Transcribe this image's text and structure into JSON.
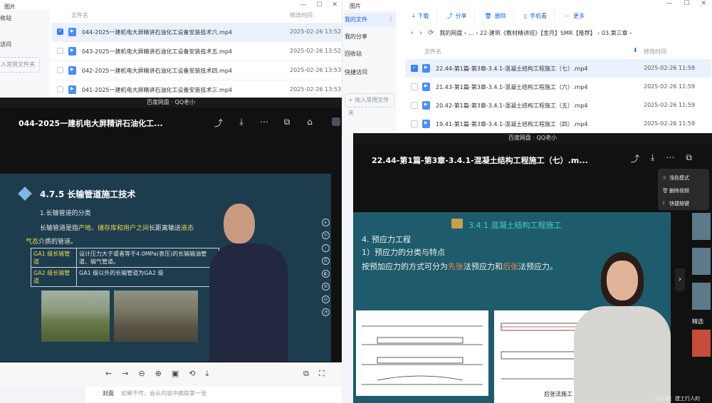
{
  "left_window": {
    "title": "图片",
    "controls": [
      "—",
      "☐",
      "✕"
    ],
    "sidebar": {
      "item1": "收站",
      "item2": "访问",
      "add_btn": "入常用文件夹"
    },
    "header": {
      "name": "文件名",
      "date": "修改时间"
    },
    "rows": [
      {
        "name": "044-2025一建机电大屏精讲石油化工设备安装技术六.mp4",
        "date": "2025-02-26 13:52",
        "selected": true
      },
      {
        "name": "043-2025一建机电大屏精讲石油化工设备安装技术五.mp4",
        "date": "2025-02-26 13:52",
        "selected": false
      },
      {
        "name": "042-2025一建机电大屏精讲石油化工设备安装技术四.mp4",
        "date": "2025-02-26 13:53",
        "selected": false
      },
      {
        "name": "041-2025一建机电大屏精讲石油化工设备安装技术三.mp4",
        "date": "2025-02-26 13:53",
        "selected": false
      }
    ]
  },
  "right_window": {
    "title": "图片",
    "controls": [
      "—",
      "☐",
      "✕"
    ],
    "sidebar": {
      "recent": "我的文件",
      "more": "⋮",
      "share": "我的分享",
      "recycle": "回收站",
      "quick": "快捷访问",
      "add_btn": "+ 拖入常用文件夹"
    },
    "toolbar": {
      "download": "下载",
      "share": "分享",
      "delete": "删除",
      "phone": "手机看",
      "more": "更多"
    },
    "breadcrumb": {
      "back": "‹",
      "forward": "›",
      "refresh": "⟳",
      "path": "我的网盘 › … › 22-建筑《教材精讲班》【金月】SMR【推荐】 › 03.第三章 ›"
    },
    "header": {
      "name": "文件名",
      "sort": "⬇",
      "date": "修改时间"
    },
    "rows": [
      {
        "name": "22.44-第1篇-第3章-3.4.1-混凝土结构工程施工（七）.mp4",
        "date": "2025-02-26 11:59",
        "selected": true
      },
      {
        "name": "21.43-第1篇-第3章-3.4.1-混凝土结构工程施工（六）.mp4",
        "date": "2025-02-26 11:59",
        "selected": false
      },
      {
        "name": "20.42-第1篇-第3章-3.4.1-混凝土结构工程施工（五）.mp4",
        "date": "2025-02-26 11:59",
        "selected": false
      },
      {
        "name": "19.41-第1篇-第3章-3.4.1-混凝土结构工程施工（四）.mp4",
        "date": "2025-02-26 11:59",
        "selected": false
      }
    ]
  },
  "left_player": {
    "app_bar": "百度网盘 · QQ老小",
    "title": "044-2025一建机电大屏精讲石油化工...",
    "actions": {
      "share": "⤴",
      "download": "⤓",
      "more": "⋯",
      "pip": "⧉",
      "pin": "⌂"
    },
    "slide": {
      "heading": "4.7.5  长输管道施工技术",
      "line1": "1.长输管道的分类",
      "line2_a": "长输管道是指",
      "line2_b": "产地、储存库和用户之间",
      "line2_c": "长距离输送",
      "line2_d": "液态",
      "line3_a": "气态",
      "line3_b": "介质的管道。",
      "table": [
        {
          "k": "GA1 级长输管道",
          "v": "设计压力大于或者等于4.0MPa(表压)的长输输油管道、输气管道。"
        },
        {
          "k": "GA2 级长输管道",
          "v": "GA1 级以外的长输管道为GA2 级"
        }
      ]
    },
    "side_ctrls": [
      "▸",
      "↻",
      "›",
      "☰",
      "◐",
      "⚙",
      "⊖",
      "◔"
    ],
    "bottom_ctrls": [
      "←",
      "→",
      "⊖",
      "⊕",
      "▣",
      "⟲",
      "⤓"
    ],
    "bottom_right": [
      "⧉",
      "⛶"
    ],
    "cover_label": "封面",
    "cover_hint": "如果不传，会从内容中摘取第一张"
  },
  "right_player": {
    "app_bar": "百度网盘 · QQ老小",
    "title": "22.44-第1篇-第3章-3.4.1-混凝土结构工程施工（七）.m...",
    "actions": {
      "share": "⤴",
      "download": "⤓",
      "more": "⋯",
      "pip": "⧉"
    },
    "menu": [
      {
        "icon": "☼",
        "label": "浅色模式"
      },
      {
        "icon": "🗑",
        "label": "删除视频"
      },
      {
        "icon": "?",
        "label": "快捷按键"
      }
    ],
    "slide": {
      "heading": "3.4.1  混凝土结构工程施工",
      "line1": "4. 预应力工程",
      "line2": "1）预应力的分类与特点",
      "line3_a": "按预加应力的方式可分为",
      "line3_b": "先张",
      "line3_c": "法预应力和",
      "line3_d": "后张",
      "line3_e": "法预应力。",
      "diagram_caption": "后张法施工"
    },
    "next": "›",
    "thumbs_label": "精选",
    "watermark": "公众号：建工行人的"
  },
  "colors": {
    "accent": "#1d62f0",
    "selected_row": "#eaf1fe",
    "highlight_yellow": "#f0d24a",
    "highlight_orange": "#ef8a4b",
    "slide_teal": "#43d2c3"
  }
}
